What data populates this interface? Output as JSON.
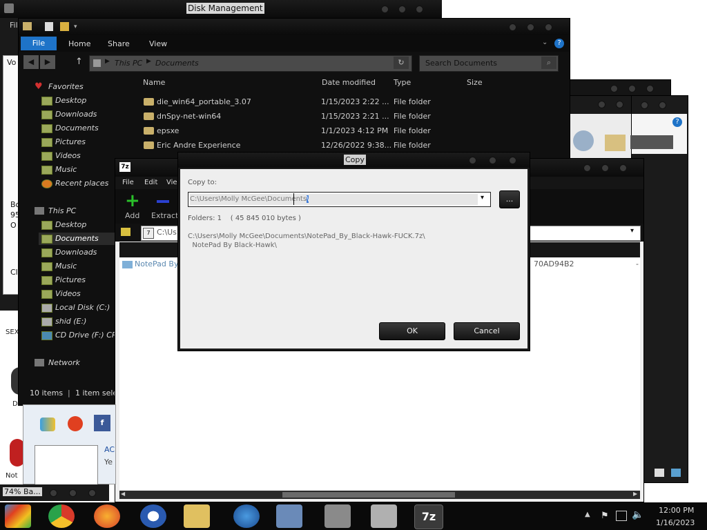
{
  "disk_mgmt": {
    "title": "Disk Management",
    "menu_fragment": "Fil",
    "vol_label": "Vo"
  },
  "explorer": {
    "ribbon_tabs": [
      "File",
      "Home",
      "Share",
      "View"
    ],
    "breadcrumb": [
      "This PC",
      "Documents"
    ],
    "search_placeholder": "Search Documents",
    "columns": {
      "name": "Name",
      "date": "Date modified",
      "type": "Type",
      "size": "Size"
    },
    "files": [
      {
        "name": "die_win64_portable_3.07",
        "date": "1/15/2023 2:22 ...",
        "type": "File folder"
      },
      {
        "name": "dnSpy-net-win64",
        "date": "1/15/2023 2:21 ...",
        "type": "File folder"
      },
      {
        "name": "epsxe",
        "date": "1/1/2023 4:12 PM",
        "type": "File folder"
      },
      {
        "name": "Eric Andre Experience",
        "date": "12/26/2022 9:38...",
        "type": "File folder"
      }
    ],
    "nav": {
      "favorites_header": "Favorites",
      "favorites": [
        "Desktop",
        "Downloads",
        "Documents",
        "Pictures",
        "Videos",
        "Music",
        "Recent places"
      ],
      "thispc_header": "This PC",
      "thispc": [
        "Desktop",
        "Documents",
        "Downloads",
        "Music",
        "Pictures",
        "Videos",
        "Local Disk (C:)",
        "shid (E:)",
        "CD Drive (F:) CPF"
      ],
      "network_header": "Network"
    },
    "status": {
      "items": "10 items",
      "selected": "1 item sele"
    }
  },
  "sevenzip": {
    "menu": [
      "File",
      "Edit",
      "Vie"
    ],
    "toolbar": {
      "add": "Add",
      "extract": "Extract"
    },
    "path_fragment": "C:\\Us",
    "row_name": "NotePad By",
    "row_hash": "70AD94B2",
    "row_dash": "-"
  },
  "copy_dialog": {
    "title": "Copy",
    "copy_to_label": "Copy to:",
    "path_before": "C:\\Users\\Molly McGee\\Docum",
    "path_mid": "ents",
    "path_selected": "\\",
    "browse_label": "...",
    "folders_info": "Folders: 1    ( 45 845 010 bytes )",
    "source_line1": "C:\\Users\\Molly McGee\\Documents\\NotePad_By_Black-Hawk-FUCK.7z\\",
    "source_line2": "  NotePad By Black-Hawk\\",
    "ok": "OK",
    "cancel": "Cancel"
  },
  "desktop": {
    "battery": "74% Ba...",
    "frag_bo": "Bo",
    "frag_95": "95",
    "frag_o": "O",
    "frag_cl": "Cl",
    "frag_sex": "SEX",
    "frag_d": "D",
    "frag_not": "Not",
    "frag_ac": "AC",
    "frag_ye": "Ye"
  },
  "taskbar": {
    "time": "12:00 PM",
    "date": "1/16/2023"
  },
  "colors": {
    "accent_blue": "#1e73c8",
    "dark_bg": "#101010",
    "dialog_bg": "#eeeeee"
  }
}
